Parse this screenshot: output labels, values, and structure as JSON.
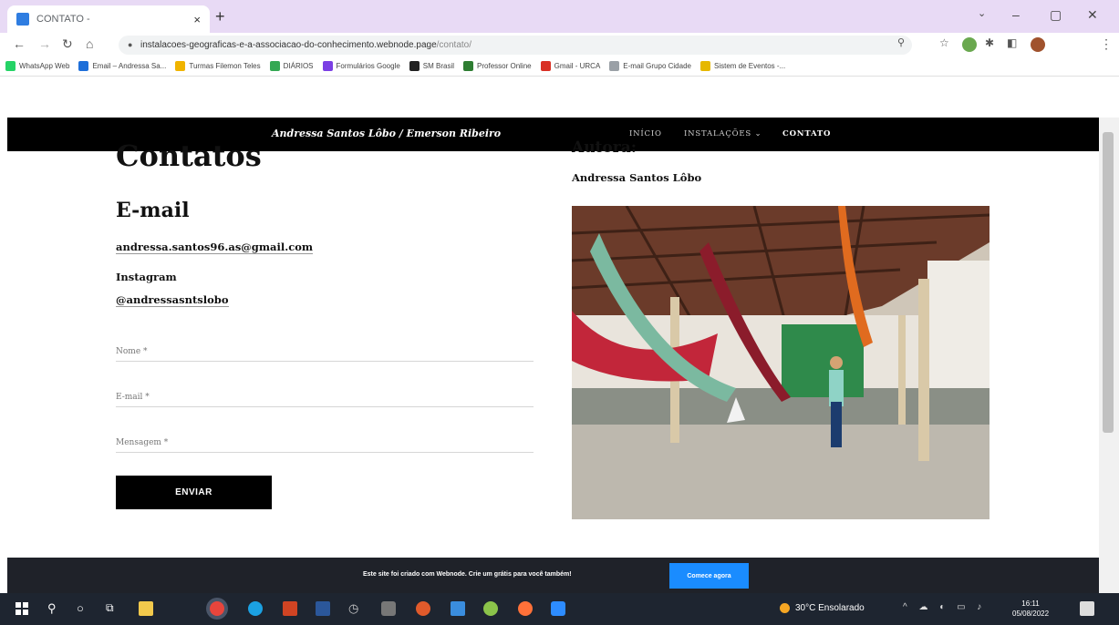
{
  "browser": {
    "tab_title": "CONTATO -",
    "url_domain": "instalacoes-geograficas-e-a-associacao-do-conhecimento.webnode.page",
    "url_path": "/contato/",
    "bookmarks": [
      {
        "label": "WhatsApp Web",
        "color": "#25d366"
      },
      {
        "label": "Email – Andressa Sa...",
        "color": "#1e6fd9"
      },
      {
        "label": "Turmas Filemon Teles",
        "color": "#f0b400"
      },
      {
        "label": "DIÁRIOS",
        "color": "#34a853"
      },
      {
        "label": "Formulários Google",
        "color": "#7b3fe4"
      },
      {
        "label": "SM Brasil",
        "color": "#222222"
      },
      {
        "label": "Professor Online",
        "color": "#2e7d32"
      },
      {
        "label": "Gmail - URCA",
        "color": "#d93025"
      },
      {
        "label": "E-mail Grupo Cidade",
        "color": "#9aa0a6"
      },
      {
        "label": "Sistem de Eventos -...",
        "color": "#e6b800"
      }
    ]
  },
  "site": {
    "brand": "Andressa Santos Lôbo / Emerson Ribeiro",
    "nav": [
      "INÍCIO",
      "INSTALAÇÕES ⌄",
      "CONTATO"
    ],
    "left": {
      "title": "Contatos",
      "email_heading": "E-mail",
      "email": "andressa.santos96.as@gmail.com",
      "instagram_label": "Instagram",
      "instagram_handle": "@andressasntslobo"
    },
    "form": {
      "name_placeholder": "Nome *",
      "email_placeholder": "E-mail *",
      "message_placeholder": "Mensagem *",
      "submit_label": "ENVIAR"
    },
    "right": {
      "heading": "Autora:",
      "author": "Andressa Santos Lôbo"
    },
    "footer": {
      "message": "Este site foi criado com Webnode. Crie um grátis para você também!",
      "cta": "Comece agora"
    }
  },
  "taskbar": {
    "weather": "30°C Ensolarado",
    "time": "16:11",
    "date": "05/08/2022"
  }
}
